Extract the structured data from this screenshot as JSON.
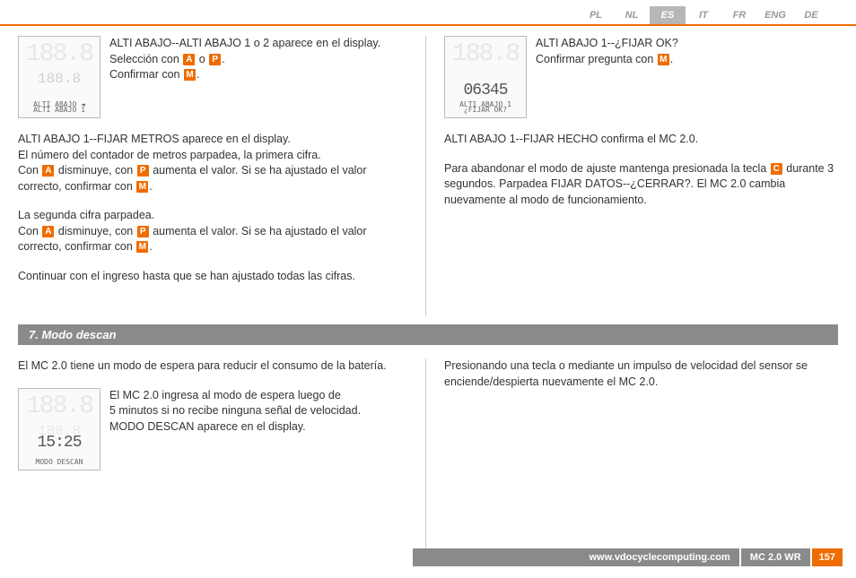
{
  "langs": [
    "PL",
    "NL",
    "ES",
    "IT",
    "FR",
    "ENG",
    "DE"
  ],
  "active_lang": "ES",
  "section1": {
    "left": {
      "display1": {
        "ghost": "188.8",
        "mid": "",
        "main": "",
        "label": "ALTI ABAJO 1"
      },
      "row1_a": "ALTI ABAJO--ALTI ABAJO 1 o 2 aparece en el display.",
      "row1_b": "Selección con ",
      "row1_c": " o ",
      "row1_d": "Confirmar con ",
      "para2_a": "ALTI ABAJO 1--FIJAR METROS aparece en el display.",
      "para2_b": "El número del contador de metros parpadea, la primera cifra.",
      "para2_c": "Con ",
      "para2_d": " disminuye, con ",
      "para2_e": " aumenta el valor. Si se ha ajustado el valor correcto, confirmar con ",
      "para3_a": "La segunda cifra parpadea.",
      "para3_b": "Con ",
      "para3_c": " disminuye, con ",
      "para3_d": " aumenta el valor. Si se ha ajustado el valor correcto, confirmar con ",
      "para4": "Continuar con el ingreso hasta que se han ajustado todas las cifras."
    },
    "right": {
      "display1": {
        "ghost": "188.8",
        "mid": "",
        "main": "06345",
        "label": "ALTI ABAJO 1\n¿FIJAR OK?"
      },
      "row1_a": "ALTI ABAJO 1--¿FIJAR OK?",
      "row1_b": "Confirmar pregunta con ",
      "para2": "ALTI ABAJO 1--FIJAR HECHO confirma el MC 2.0.",
      "para3_a": "Para abandonar el modo de ajuste mantenga presionada la tecla ",
      "para3_b": " durante 3 segundos. Parpadea FIJAR DATOS--¿CERRAR?. El MC 2.0 cambia nuevamente al modo de funcionamiento."
    }
  },
  "section2": {
    "title": "7. Modo descan",
    "left": {
      "para1": "El MC 2.0 tiene un modo de espera para reducir el consumo de la batería.",
      "display1": {
        "ghost": "188.8",
        "mid": "",
        "main": "15:25",
        "label": "MODO DESCAN"
      },
      "row1_a": "El MC 2.0 ingresa al modo de espera luego de",
      "row1_b": "5 minutos si no recibe ninguna señal de velocidad.",
      "row1_c": "MODO DESCAN aparece en el display."
    },
    "right": {
      "para1": "Presionando una tecla o mediante un impulso de velocidad del sensor se enciende/despierta nuevamente el MC 2.0."
    }
  },
  "footer": {
    "url": "www.vdocyclecomputing.com",
    "model": "MC 2.0 WR",
    "page": "157"
  },
  "keys": {
    "A": "A",
    "P": "P",
    "M": "M",
    "C": "C"
  }
}
